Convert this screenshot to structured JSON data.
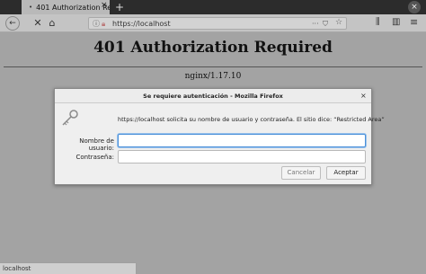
{
  "browser": {
    "tab_title": "401 Authorization Requi",
    "url": "https://localhost",
    "tab_close_glyph": "×",
    "new_tab_glyph": "+",
    "window_close_glyph": "×",
    "icons": {
      "back": "back-arrow-icon",
      "stop": "stop-icon",
      "home": "home-icon",
      "info": "info-icon",
      "lock": "insecure-lock-icon",
      "more": "page-actions-icon",
      "shield": "tracking-shield-icon",
      "star": "bookmark-star-icon",
      "library": "library-icon",
      "sidebar": "sidebar-icon",
      "menu": "hamburger-menu-icon",
      "key": "key-icon"
    }
  },
  "page": {
    "title": "401 Authorization Required",
    "server": "nginx/1.17.10"
  },
  "dialog": {
    "title": "Se requiere autenticación - Mozilla Firefox",
    "message": "https://localhost solicita su nombre de usuario y contraseña. El sitio dice: “Restricted Area”",
    "username_label": "Nombre de usuario:",
    "password_label": "Contraseña:",
    "username_value": "",
    "password_value": "",
    "cancel_label": "Cancelar",
    "accept_label": "Aceptar",
    "close_glyph": "×"
  },
  "statusbar": {
    "text": "localhost"
  },
  "colors": {
    "focus_border": "#4a90d9",
    "page_background": "#a3a3a3"
  }
}
